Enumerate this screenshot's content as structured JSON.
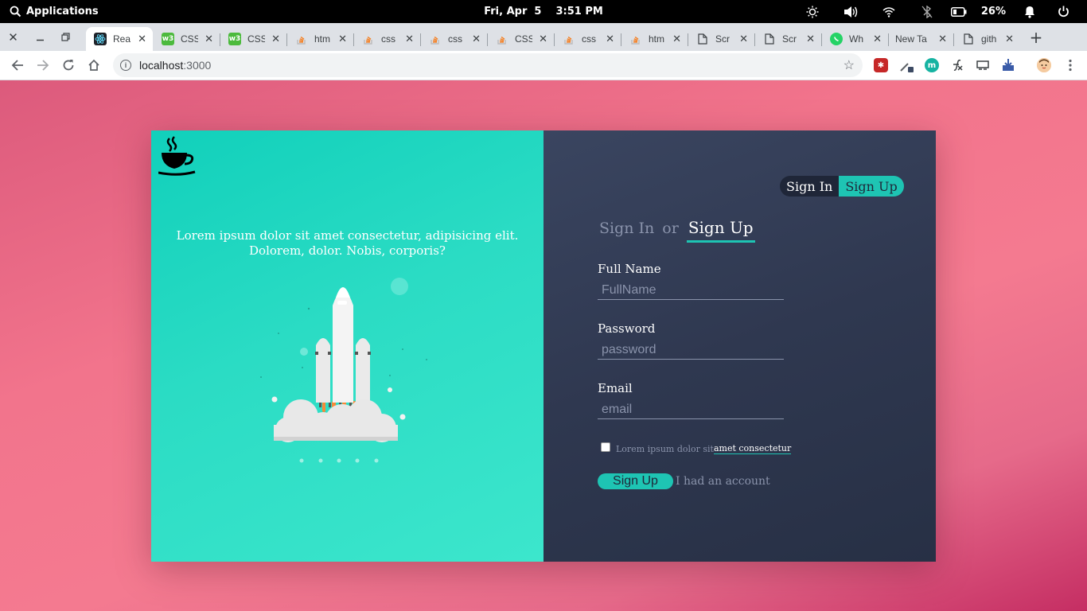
{
  "system_bar": {
    "activities_label": "Applications",
    "date": "Fri, Apr  5",
    "time": "3:51 PM",
    "battery_percent": "26%"
  },
  "browser": {
    "tabs": [
      {
        "title": "Rea",
        "favicon": "react-icon",
        "active": true
      },
      {
        "title": "CSS",
        "favicon": "w3schools-icon"
      },
      {
        "title": "CSS",
        "favicon": "w3schools-icon"
      },
      {
        "title": "htm",
        "favicon": "stackoverflow-icon"
      },
      {
        "title": "css",
        "favicon": "stackoverflow-icon"
      },
      {
        "title": "css",
        "favicon": "stackoverflow-icon"
      },
      {
        "title": "CSS",
        "favicon": "stackoverflow-icon"
      },
      {
        "title": "css",
        "favicon": "stackoverflow-icon"
      },
      {
        "title": "htm",
        "favicon": "stackoverflow-icon"
      },
      {
        "title": "Scr",
        "favicon": "document-icon"
      },
      {
        "title": "Scr",
        "favicon": "document-icon"
      },
      {
        "title": "Wh",
        "favicon": "whatsapp-icon"
      },
      {
        "title": "New Ta",
        "favicon": "none"
      },
      {
        "title": "gith",
        "favicon": "document-icon"
      }
    ],
    "address": {
      "host": "localhost",
      "port": ":3000"
    }
  },
  "left_panel": {
    "tagline": "Lorem ipsum dolor sit amet consectetur, adipisicing elit. Dolorem, dolor. Nobis, corporis?"
  },
  "form_switcher": {
    "sign_in": "Sign In",
    "sign_up": "Sign Up"
  },
  "form_title": {
    "sign_in": "Sign In",
    "or": "or",
    "sign_up": "Sign Up"
  },
  "fields": {
    "full_name": {
      "label": "Full Name",
      "placeholder": "FullName",
      "value": ""
    },
    "password": {
      "label": "Password",
      "placeholder": "password",
      "value": ""
    },
    "email": {
      "label": "Email",
      "placeholder": "email",
      "value": ""
    }
  },
  "terms": {
    "text": "Lorem ipsum dolor sit",
    "link": "amet consectetur",
    "checked": false
  },
  "actions": {
    "submit": "Sign Up",
    "alt_link": "I had an account"
  },
  "colors": {
    "accent": "#1ec4b3",
    "left_panel": "#2bdcc4",
    "right_panel": "#2f3850",
    "page_background": "#f2748c"
  }
}
